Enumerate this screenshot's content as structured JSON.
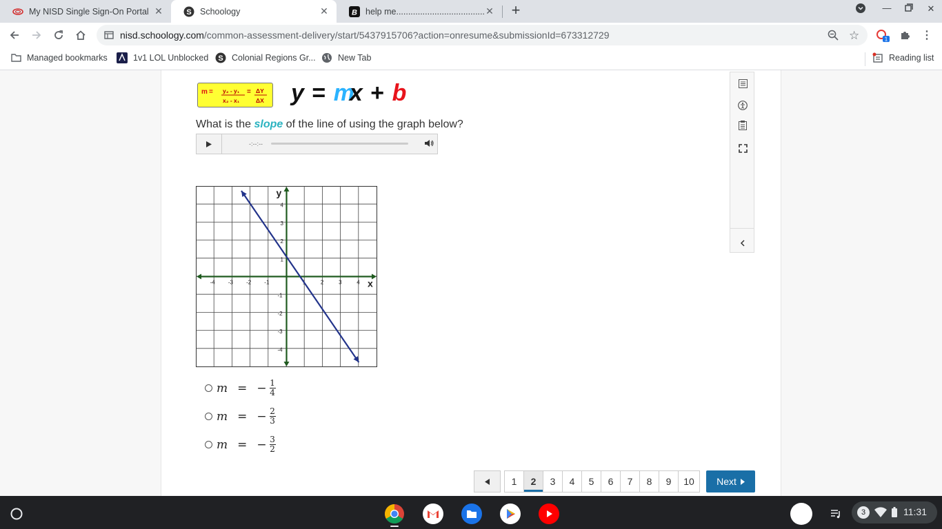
{
  "tabs": [
    {
      "title": "My NISD Single Sign-On Portal",
      "active": false
    },
    {
      "title": "Schoology",
      "active": true
    },
    {
      "title": "help me.........................................",
      "active": false
    }
  ],
  "address": {
    "host": "nisd.schoology.com",
    "path": "/common-assessment-delivery/start/5437915706?action=onresume&submissionId=673312729"
  },
  "extension_badge": "1",
  "bookmarks": [
    "Managed bookmarks",
    "1v1 LOL Unblocked",
    "Colonial Regions Gr...",
    "New Tab"
  ],
  "reading_list": "Reading list",
  "formula": {
    "m_label": "m",
    "eq": "=",
    "num": "y₂ - y₁",
    "den": "x₂ - x₁",
    "delta_num": "ΔY",
    "delta_den": "ΔX",
    "slope_form": {
      "y": "y",
      "eq": "=",
      "m": "m",
      "x": "x",
      "plus": "+",
      "b": "b"
    }
  },
  "question": {
    "before": "What is the",
    "keyword": "slope",
    "after": "of the line of using the graph below?"
  },
  "audio": {
    "time": "-:--:--"
  },
  "graph": {
    "x_label": "x",
    "y_label": "y",
    "x_ticks": [
      "-4",
      "-3",
      "-2",
      "-1",
      "1",
      "2",
      "3",
      "4"
    ],
    "y_ticks": [
      "4",
      "3",
      "2",
      "1",
      "-1",
      "-2",
      "-3",
      "-4"
    ],
    "line": {
      "x1": -2.5,
      "y1": 4.75,
      "x2": 4,
      "y2": -4.75,
      "color": "#22338a"
    },
    "axis_color": "#1f5a1f"
  },
  "choices": [
    {
      "lhs": "m",
      "eq": "=",
      "sign": "−",
      "num": "1",
      "den": "4"
    },
    {
      "lhs": "m",
      "eq": "=",
      "sign": "−",
      "num": "2",
      "den": "3"
    },
    {
      "lhs": "m",
      "eq": "=",
      "sign": "−",
      "num": "3",
      "den": "2"
    }
  ],
  "pager": {
    "pages": [
      "1",
      "2",
      "3",
      "4",
      "5",
      "6",
      "7",
      "8",
      "9",
      "10"
    ],
    "current": "2",
    "next_label": "Next"
  },
  "shelf": {
    "notification_count": "3",
    "time": "11:31"
  },
  "colors": {
    "accent": "#1a6fa7",
    "formula_bg": "#ffff33",
    "slope_m": "#2bb3ff",
    "slope_b": "#e8141c",
    "keyword": "#2bb3c0"
  }
}
